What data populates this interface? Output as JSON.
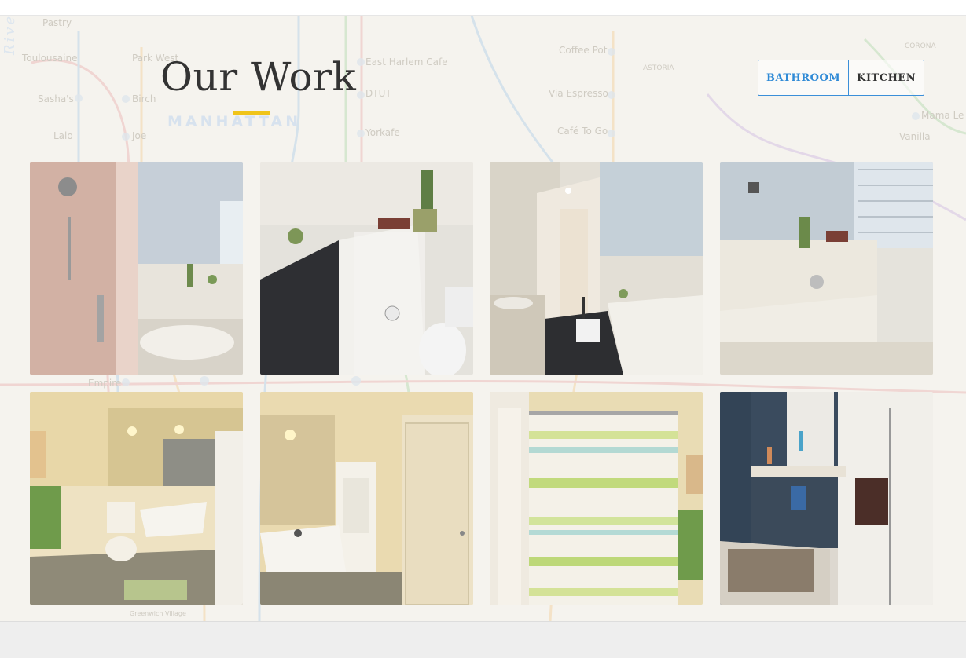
{
  "section": {
    "title": "Our Work",
    "accent_color": "#f0c419",
    "link_color": "#2f8ad6"
  },
  "filters": [
    {
      "label": "BATHROOM",
      "active": true
    },
    {
      "label": "KITCHEN",
      "active": false
    }
  ],
  "map_labels": {
    "river": "River",
    "district": "MANHATTAN",
    "stops": [
      "Pastry",
      "Toulousaine",
      "Park West",
      "Sasha's",
      "Birch",
      "Lalo",
      "Joe",
      "East Harlem Cafe",
      "DTUT",
      "Yorkafe",
      "Coffee Pot",
      "ASTORIA",
      "Via Espresso",
      "Café To Go",
      "CORONA",
      "Mama Le",
      "Vanilla",
      "Empire",
      "Greenwich Village"
    ]
  },
  "gallery": [
    {
      "subject": "shower and tub bathroom photo"
    },
    {
      "subject": "tub with white subway tile wall and toilet photo"
    },
    {
      "subject": "long bathroom with vanity and tub photo"
    },
    {
      "subject": "tub with tile wall and window photo"
    },
    {
      "subject": "yellow bathroom with toilet and trough sink photo"
    },
    {
      "subject": "trough sink and white cabinet photo"
    },
    {
      "subject": "striped shower curtain photo"
    },
    {
      "subject": "marble tub with glass shower photo"
    }
  ]
}
